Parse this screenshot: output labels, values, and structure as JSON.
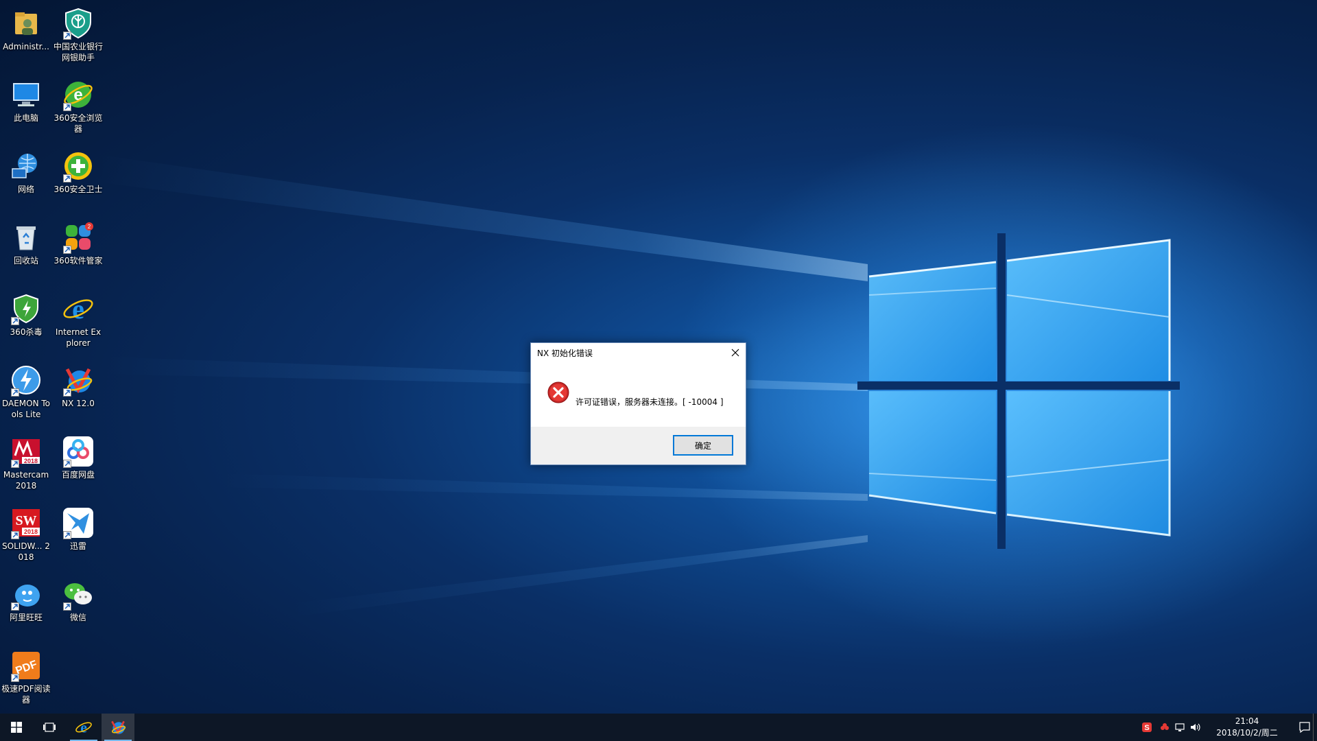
{
  "desktop": {
    "icons": [
      {
        "label": "Administr...",
        "icon": "user-folder-icon"
      },
      {
        "label": "中国农业银行网银助手",
        "icon": "abc-bank-icon"
      },
      {
        "label": "此电脑",
        "icon": "computer-icon"
      },
      {
        "label": "360安全浏览器",
        "icon": "360-browser-icon"
      },
      {
        "label": "网络",
        "icon": "network-icon"
      },
      {
        "label": "360安全卫士",
        "icon": "360-security-icon"
      },
      {
        "label": "回收站",
        "icon": "recycle-bin-icon"
      },
      {
        "label": "360软件管家",
        "icon": "360-software-manager-icon",
        "badge": "2"
      },
      {
        "label": "360杀毒",
        "icon": "360-antivirus-icon"
      },
      {
        "label": "Internet Explorer",
        "icon": "internet-explorer-icon"
      },
      {
        "label": "DAEMON Tools Lite",
        "icon": "daemon-tools-icon"
      },
      {
        "label": "NX 12.0",
        "icon": "nx-icon"
      },
      {
        "label": "Mastercam 2018",
        "icon": "mastercam-icon"
      },
      {
        "label": "百度网盘",
        "icon": "baidu-netdisk-icon"
      },
      {
        "label": "SOLIDW... 2018",
        "icon": "solidworks-icon"
      },
      {
        "label": "迅雷",
        "icon": "xunlei-icon"
      },
      {
        "label": "阿里旺旺",
        "icon": "aliwangwang-icon"
      },
      {
        "label": "微信",
        "icon": "wechat-icon"
      },
      {
        "label": "极速PDF阅读器",
        "icon": "pdf-reader-icon"
      }
    ]
  },
  "dialog": {
    "title": "NX 初始化错误",
    "message": "许可证错误，服务器未连接。[ -10004 ]",
    "ok_label": "确定"
  },
  "taskbar": {
    "clock_time": "21:04",
    "clock_date": "2018/10/2/周二"
  },
  "colors": {
    "accent": "#0078d7",
    "taskbar": "#0d1726",
    "error_red": "#d32f2f"
  }
}
